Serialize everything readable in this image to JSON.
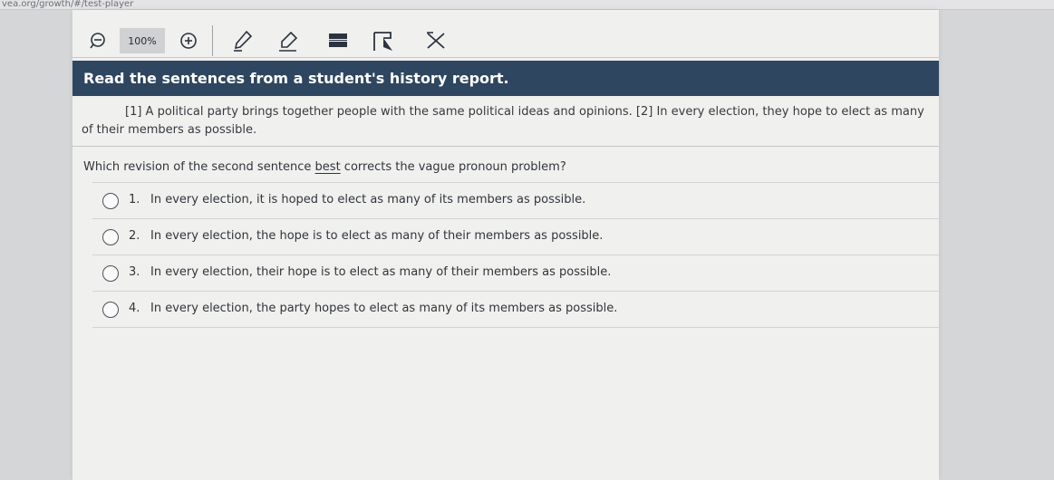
{
  "browser": {
    "url_fragment": "vea.org/growth/#/test-player"
  },
  "toolbar": {
    "zoom_label": "100%",
    "zoom_out_icon": "zoom-out-icon",
    "zoom_in_icon": "zoom-in-icon",
    "tools": [
      "pencil-icon",
      "highlighter-icon",
      "line-reader-icon",
      "flag-icon",
      "answer-eliminator-icon"
    ]
  },
  "banner": {
    "text": "Read the sentences from a student's history report."
  },
  "passage": {
    "text": "[1] A political party brings together people with the same political ideas and opinions. [2] In every election, they hope to elect as many of their members as possible."
  },
  "question": {
    "prefix": "Which revision of the second sentence ",
    "emphasis": "best",
    "suffix": " corrects the vague pronoun problem?"
  },
  "choices": [
    {
      "number": "1.",
      "text": "In every election, it is hoped to elect as many of its members as possible."
    },
    {
      "number": "2.",
      "text": "In every election, the hope is to elect as many of their members as possible."
    },
    {
      "number": "3.",
      "text": "In every election, their hope is to elect as many of their members as possible."
    },
    {
      "number": "4.",
      "text": "In every election, the party hopes to elect as many of its members as possible."
    }
  ],
  "colors": {
    "banner_bg": "#2e4660",
    "content_bg": "#f0f0ee",
    "page_bg": "#d4d6d8"
  }
}
